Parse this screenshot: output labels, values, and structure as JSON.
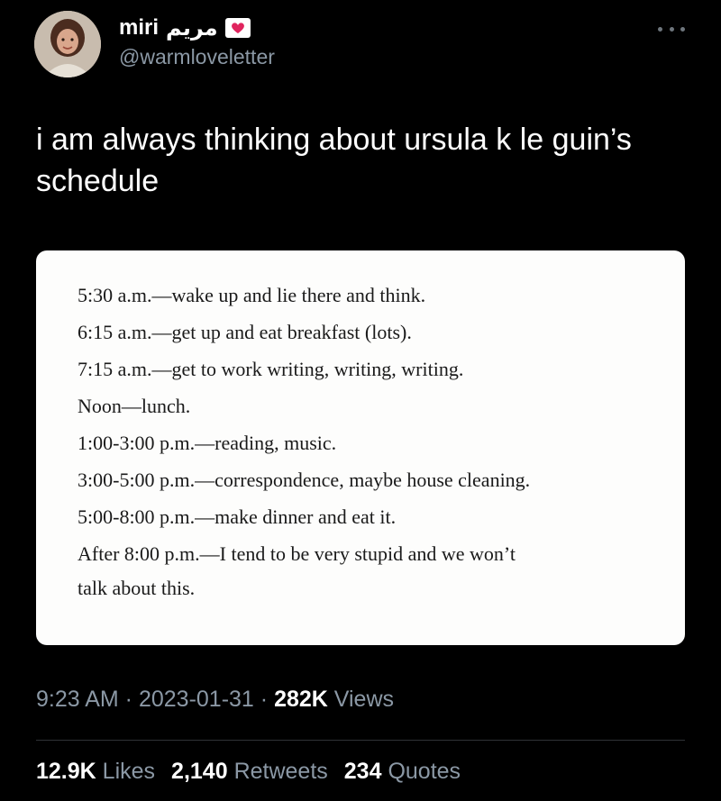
{
  "author": {
    "display_name": "miri",
    "arabic_name": "مريم",
    "handle": "@warmloveletter",
    "badge_icon": "love-letter-icon"
  },
  "tweet": {
    "text": "i am always thinking about ursula k le guin’s schedule"
  },
  "image_schedule": [
    "5:30 a.m.—wake up and lie there and think.",
    "6:15 a.m.—get up and eat breakfast (lots).",
    "7:15 a.m.—get to work writing, writing, writing.",
    "Noon—lunch.",
    "1:00-3:00 p.m.—reading, music.",
    "3:00-5:00 p.m.—correspondence, maybe house cleaning.",
    "5:00-8:00 p.m.—make dinner and eat it.",
    "After 8:00 p.m.—I tend to be very stupid and we won’t",
    "talk about this."
  ],
  "meta": {
    "time": "9:23 AM",
    "separator": " · ",
    "date": "2023-01-31",
    "views_count": "282K",
    "views_label": "Views"
  },
  "stats": {
    "likes_count": "12.9K",
    "likes_label": "Likes",
    "retweets_count": "2,140",
    "retweets_label": "Retweets",
    "quotes_count": "234",
    "quotes_label": "Quotes"
  },
  "colors": {
    "background": "#000000",
    "secondary_text": "#8b98a5",
    "badge_heart": "#e0245e"
  }
}
